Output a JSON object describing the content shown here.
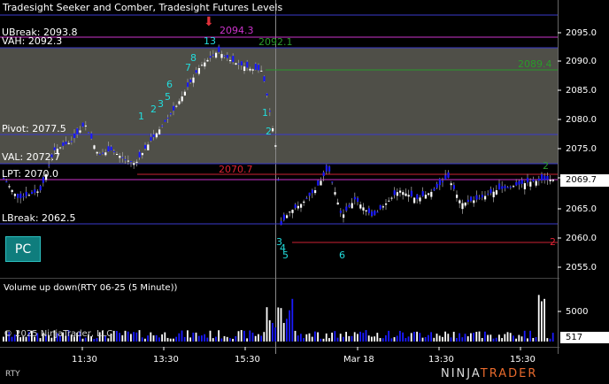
{
  "header": {
    "title": "Tradesight Seeker and Comber, Tradesight Futures Levels",
    "title_prefix": "RTY 06-25"
  },
  "levels": {
    "ubreak": "UBreak: 2093.8",
    "vah": "VAH: 2092.3",
    "pivot": "Pivot: 2077.5",
    "val": "VAL: 2072.7",
    "lpt": "LPT: 2070.0",
    "lbreak": "LBreak: 2062.5",
    "magenta_top": "2094.3",
    "green_vah": "2092.1",
    "green_right": "2089.4",
    "red_mid": "2070.7",
    "red_right": "2",
    "green_right_small": "2"
  },
  "price_axis": [
    "2095.0",
    "2090.0",
    "2085.0",
    "2080.0",
    "2075.0",
    "2070.0",
    "2065.0",
    "2060.0",
    "2055.0"
  ],
  "current_price": "2069.7",
  "volume_panel": {
    "label": "Volume up down(RTY 06-25 (5 Minute))",
    "axis": "5000",
    "current": "517"
  },
  "time_axis": [
    "11:30",
    "13:30",
    "15:30",
    "Mar 18",
    "13:30",
    "15:30"
  ],
  "counts": {
    "c13": "13",
    "c1": "1",
    "c2": "2",
    "c3": "3",
    "c4": "4",
    "c5": "5",
    "c6": "6",
    "c7": "7",
    "c8": "8",
    "c9": "9"
  },
  "button": {
    "pc": "PC"
  },
  "copyright": "© 2025 NinjaTrader, LLC",
  "brand": {
    "ninja": "NINJA",
    "trader": "TRADER"
  },
  "instrument": "RTY",
  "colors": {
    "up_candle": "#ffffff",
    "down_candle": "#1a1aff",
    "level_blue": "#2222cc",
    "band_fill": "#6e6e64",
    "magenta": "#cc33cc",
    "green": "#2a9a2a",
    "cyan": "#22dddd",
    "red": "#dd2233"
  }
}
